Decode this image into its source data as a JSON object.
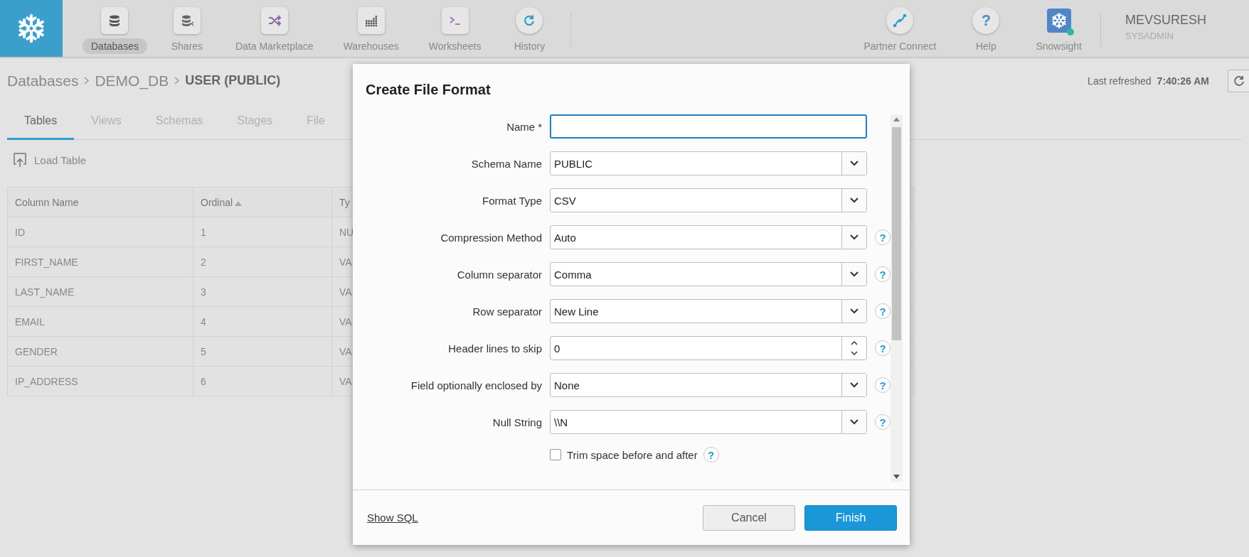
{
  "app_bar": {
    "nav": [
      {
        "label": "Databases",
        "selected": true
      },
      {
        "label": "Shares",
        "selected": false
      },
      {
        "label": "Data Marketplace",
        "selected": false
      },
      {
        "label": "Warehouses",
        "selected": false
      },
      {
        "label": "Worksheets",
        "selected": false
      },
      {
        "label": "History",
        "selected": false
      }
    ],
    "tools": [
      {
        "label": "Partner Connect",
        "kind": "connect"
      },
      {
        "label": "Help",
        "kind": "help",
        "glyph": "?"
      },
      {
        "label": "Snowsight",
        "kind": "snowsight"
      }
    ],
    "user": {
      "name": "MEVSURESH",
      "role": "SYSADMIN"
    }
  },
  "breadcrumb": [
    {
      "label": "Databases",
      "current": false
    },
    {
      "label": "DEMO_DB",
      "current": false
    },
    {
      "label": "USER (PUBLIC)",
      "current": true
    }
  ],
  "last_refreshed": {
    "label": "Last refreshed",
    "time": "7:40:26 AM"
  },
  "tabs": [
    {
      "label": "Tables",
      "selected": true
    },
    {
      "label": "Views",
      "selected": false
    },
    {
      "label": "Schemas",
      "selected": false
    },
    {
      "label": "Stages",
      "selected": false
    },
    {
      "label": "File",
      "selected": false
    }
  ],
  "toolbar": {
    "load_table": "Load Table"
  },
  "table": {
    "columns": [
      {
        "label": "Column Name"
      },
      {
        "label": "Ordinal",
        "sorted": true
      },
      {
        "label": "Ty"
      }
    ],
    "rows": [
      [
        "ID",
        "1",
        "NU"
      ],
      [
        "FIRST_NAME",
        "2",
        "VA"
      ],
      [
        "LAST_NAME",
        "3",
        "VA"
      ],
      [
        "EMAIL",
        "4",
        "VA"
      ],
      [
        "GENDER",
        "5",
        "VA"
      ],
      [
        "IP_ADDRESS",
        "6",
        "VA"
      ]
    ]
  },
  "dialog": {
    "title": "Create File Format",
    "fields": [
      {
        "kind": "text",
        "label": "Name",
        "required_mark": "*",
        "focused": true
      },
      {
        "kind": "select",
        "label": "Schema Name",
        "value": "PUBLIC"
      },
      {
        "kind": "select",
        "label": "Format Type",
        "value": "CSV"
      },
      {
        "kind": "select",
        "label": "Compression Method",
        "value": "Auto",
        "help": "?"
      },
      {
        "kind": "select",
        "label": "Column separator",
        "value": "Comma",
        "help": "?"
      },
      {
        "kind": "select",
        "label": "Row separator",
        "value": "New Line",
        "help": "?"
      },
      {
        "kind": "number",
        "label": "Header lines to skip",
        "value": "0",
        "help": "?"
      },
      {
        "kind": "select",
        "label": "Field optionally enclosed by",
        "value": "None",
        "help": "?"
      },
      {
        "kind": "select",
        "label": "Null String",
        "value": "\\\\N",
        "help": "?"
      },
      {
        "kind": "checkbox",
        "label": "Trim space before and after",
        "checked": false,
        "help": "?"
      }
    ],
    "show_sql": "Show SQL",
    "buttons": [
      {
        "label": "Cancel",
        "kind": "secondary"
      },
      {
        "label": "Finish",
        "kind": "primary"
      }
    ]
  }
}
